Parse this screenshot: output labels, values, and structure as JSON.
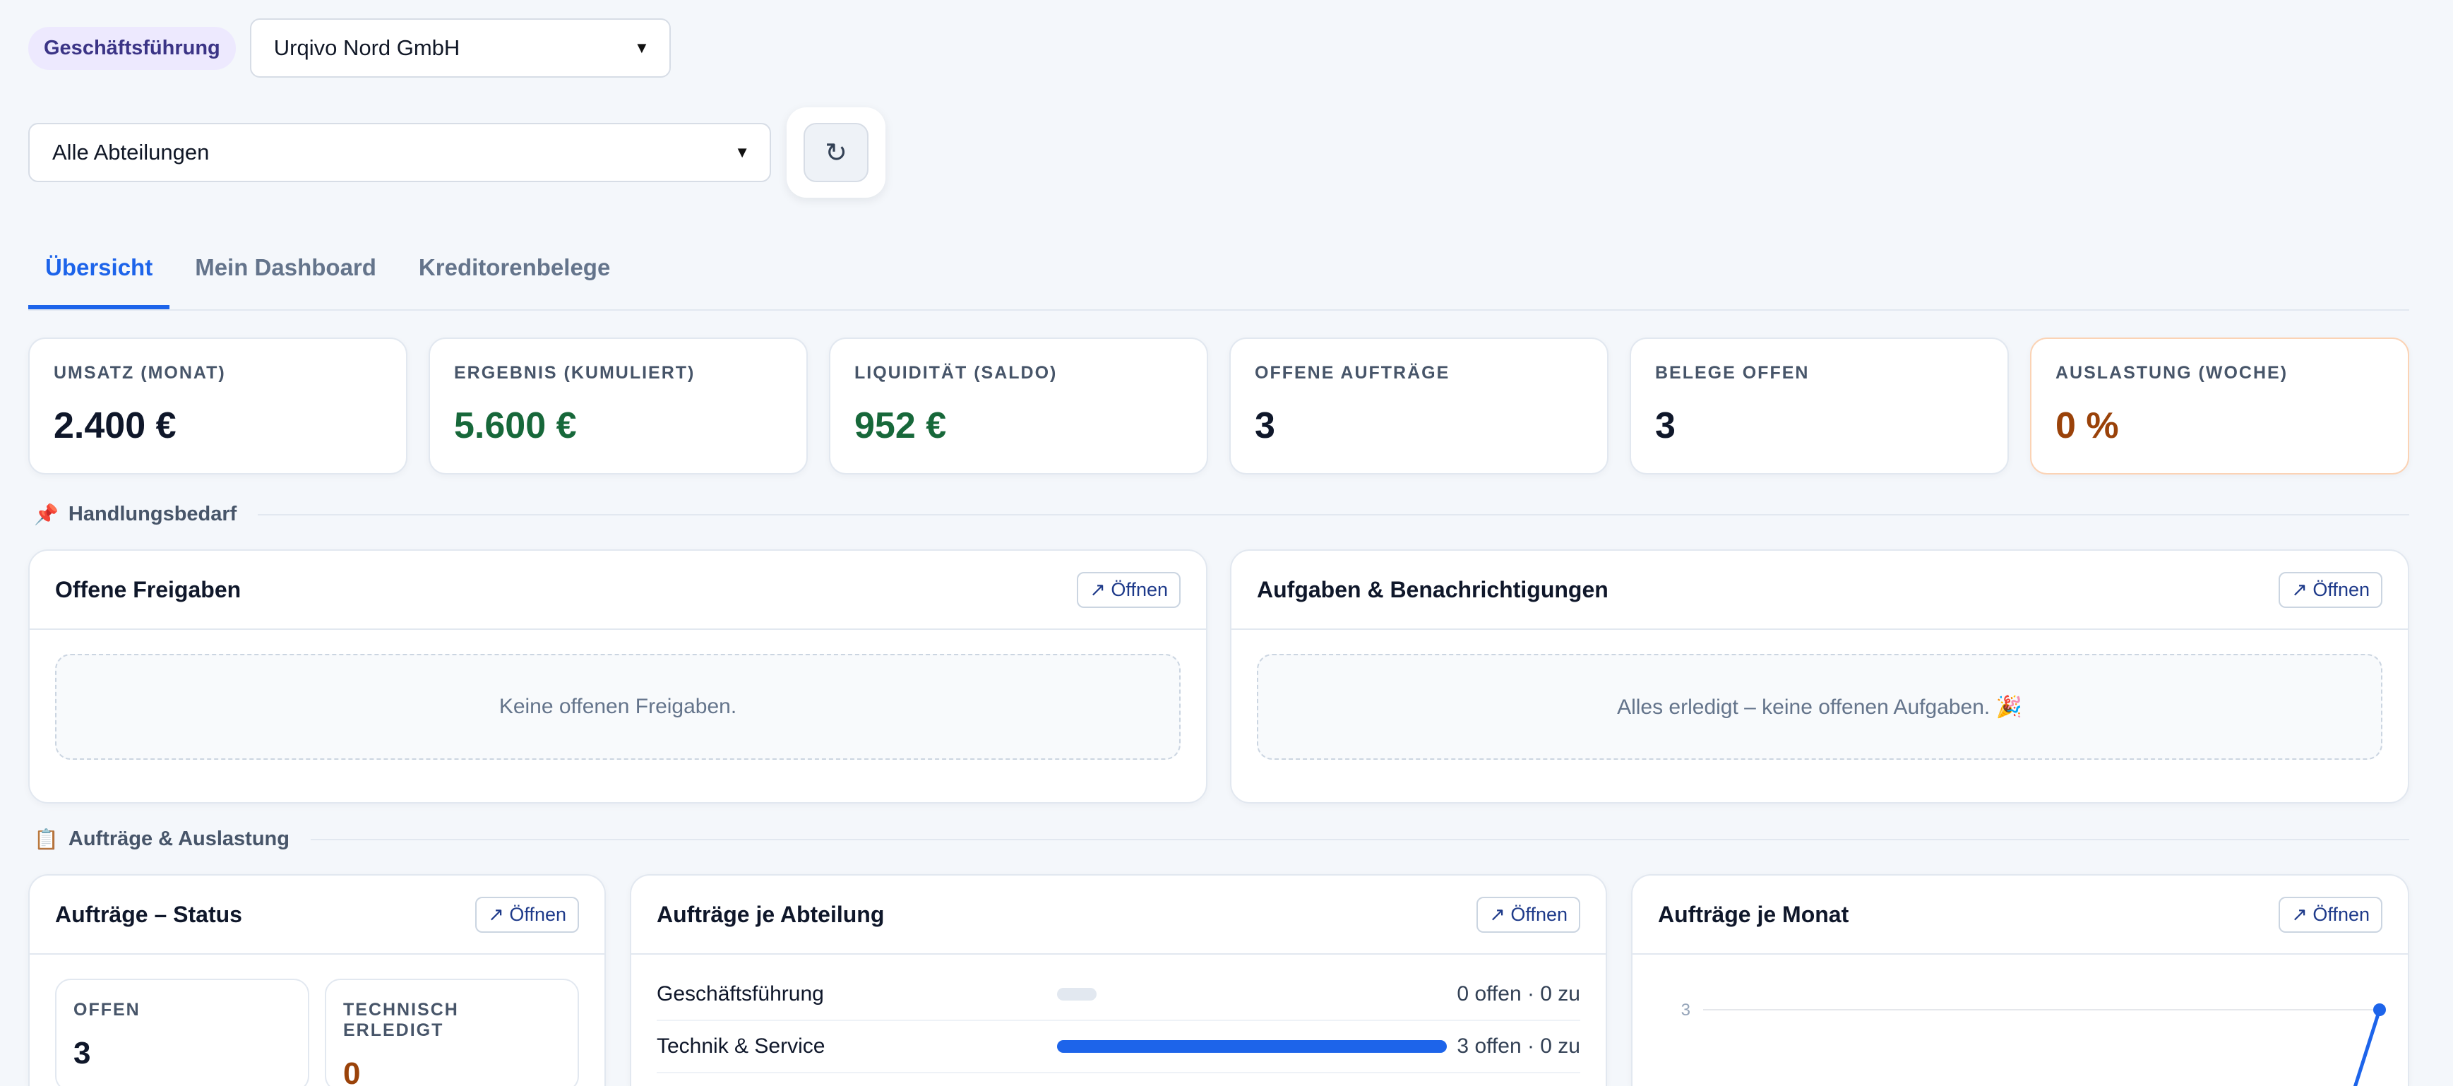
{
  "header": {
    "role_badge": "Geschäftsführung",
    "company_select": "Urqivo Nord GmbH",
    "department_select": "Alle Abteilungen",
    "refresh_icon": "↻"
  },
  "tabs": [
    {
      "label": "Übersicht",
      "active": true
    },
    {
      "label": "Mein Dashboard",
      "active": false
    },
    {
      "label": "Kreditorenbelege",
      "active": false
    }
  ],
  "kpis": [
    {
      "label": "UMSATZ (MONAT)",
      "value": "2.400 €"
    },
    {
      "label": "ERGEBNIS (KUMULIERT)",
      "value": "5.600 €"
    },
    {
      "label": "LIQUIDITÄT (SALDO)",
      "value": "952 €"
    },
    {
      "label": "OFFENE AUFTRÄGE",
      "value": "3"
    },
    {
      "label": "BELEGE OFFEN",
      "value": "3"
    },
    {
      "label": "AUSLASTUNG (WOCHE)",
      "value": "0 %"
    }
  ],
  "sections": {
    "action": {
      "icon": "📌",
      "title": "Handlungsbedarf"
    },
    "orders": {
      "icon": "📋",
      "title": "Aufträge & Auslastung"
    }
  },
  "open_label": "↗ Öffnen",
  "panels": {
    "approvals": {
      "title": "Offene Freigaben",
      "empty": "Keine offenen Freigaben."
    },
    "tasks": {
      "title": "Aufgaben & Benachrichtigungen",
      "empty": "Alles erledigt – keine offenen Aufgaben. 🎉"
    },
    "status": {
      "title": "Aufträge – Status",
      "boxes": [
        {
          "label": "OFFEN",
          "value": "3"
        },
        {
          "label": "TECHNISCH ERLEDIGT",
          "value": "0"
        }
      ]
    },
    "by_department": {
      "title": "Aufträge je Abteilung",
      "rows": [
        {
          "name": "Geschäftsführung",
          "meta": "0 offen · 0 zu",
          "fill": 0
        },
        {
          "name": "Technik & Service",
          "meta": "3 offen · 0 zu",
          "fill": 1
        }
      ]
    },
    "by_month": {
      "title": "Aufträge je Monat"
    }
  },
  "chart_data": {
    "type": "line",
    "title": "Aufträge je Monat",
    "y_ticks": [
      "3"
    ],
    "series": [
      {
        "values": [
          0,
          3
        ]
      }
    ]
  }
}
